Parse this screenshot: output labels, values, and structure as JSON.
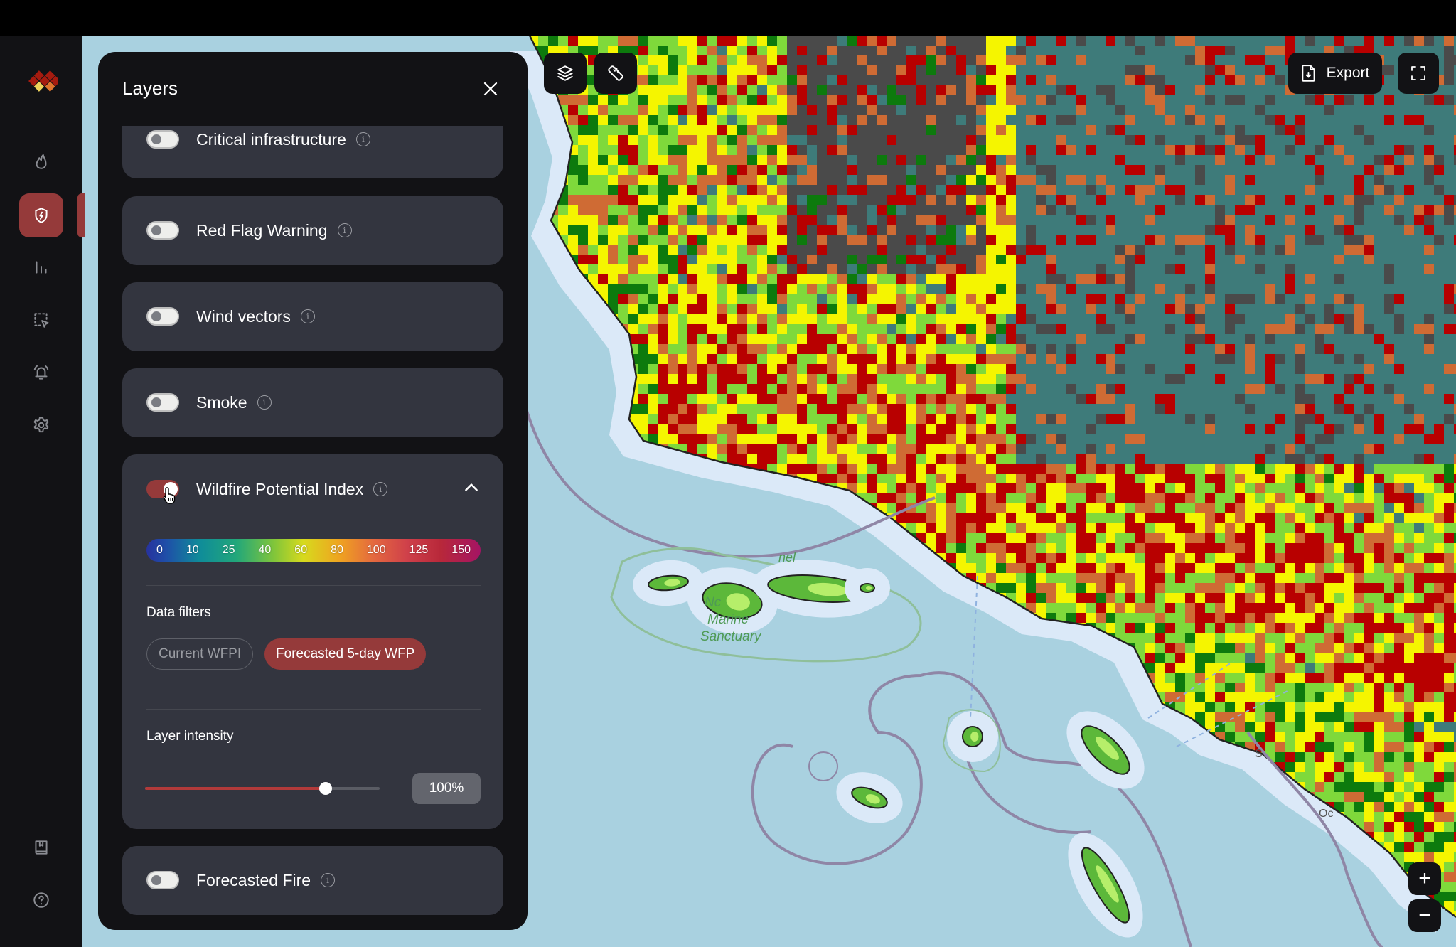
{
  "panel": {
    "title": "Layers",
    "layers": [
      {
        "label": "Critical infrastructure",
        "enabled": false
      },
      {
        "label": "Red Flag Warning",
        "enabled": false
      },
      {
        "label": "Wind vectors",
        "enabled": false
      },
      {
        "label": "Smoke",
        "enabled": false
      },
      {
        "label": "Wildfire Potential Index",
        "enabled": true,
        "expanded": true
      },
      {
        "label": "Forecasted Fire",
        "enabled": false
      }
    ],
    "wfpi": {
      "legend_stops": [
        "0",
        "10",
        "25",
        "40",
        "60",
        "80",
        "100",
        "125",
        "150"
      ],
      "data_filters_label": "Data filters",
      "filters": [
        {
          "label": "Current WFPI",
          "selected": false
        },
        {
          "label": "Forecasted 5-day WFP",
          "selected": true
        }
      ],
      "intensity_label": "Layer intensity",
      "intensity_value": 100,
      "intensity_text": "100%"
    }
  },
  "sidebar": {
    "items": [
      {
        "name": "fires",
        "icon": "flame-icon",
        "active": false
      },
      {
        "name": "risk",
        "icon": "shield-bolt-icon",
        "active": true
      },
      {
        "name": "analytics",
        "icon": "bar-chart-icon",
        "active": false
      },
      {
        "name": "area-select",
        "icon": "select-area-icon",
        "active": false
      },
      {
        "name": "alerts",
        "icon": "bell-icon",
        "active": false
      },
      {
        "name": "settings",
        "icon": "gear-icon",
        "active": false
      }
    ],
    "bottom_items": [
      {
        "name": "guide",
        "icon": "book-icon"
      },
      {
        "name": "help",
        "icon": "help-icon"
      }
    ]
  },
  "map": {
    "toolbar": {
      "layers_icon": "layers-icon",
      "measure_icon": "ruler-icon",
      "export_label": "Export",
      "fullscreen_icon": "fullscreen-icon"
    },
    "zoom": {
      "in": "+",
      "out": "−"
    },
    "labels": {
      "sanctuary_line1": "Nc",
      "sanctuary_line2": "Marine",
      "sanctuary_line3": "Sanctuary",
      "sanctuary_partial": "nel",
      "coast_label_1": "S",
      "coast_label_2": "Oc"
    },
    "colors": {
      "ocean": "#a9d1e0",
      "coastal_buffer": "#dbe9f8",
      "very_low": "#0d7a0d",
      "low": "#7fd93b",
      "moderate": "#f5f500",
      "high": "#cf6b34",
      "very_high": "#b80000",
      "non_burnable": "#4a4a4a",
      "agricultural": "#3e7b7a",
      "snow": "#ffffff"
    }
  }
}
